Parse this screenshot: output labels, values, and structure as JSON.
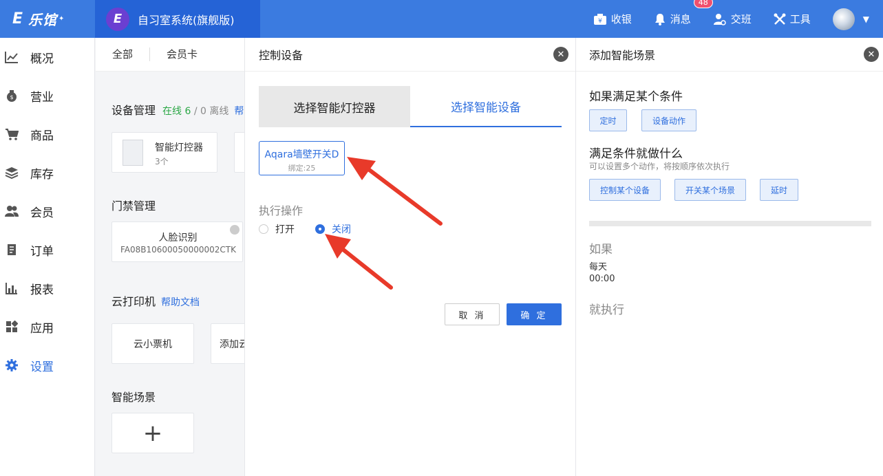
{
  "header": {
    "brand": "乐馆",
    "store_name": "自习室系统(旗舰版)",
    "actions": [
      {
        "label": "收银",
        "icon": "cashier-icon"
      },
      {
        "label": "消息",
        "icon": "bell-icon",
        "badge": "48"
      },
      {
        "label": "交班",
        "icon": "handover-icon"
      },
      {
        "label": "工具",
        "icon": "tools-icon"
      }
    ]
  },
  "sidebar": {
    "items": [
      {
        "label": "概况",
        "icon": "chart-line-icon"
      },
      {
        "label": "营业",
        "icon": "money-bag-icon"
      },
      {
        "label": "商品",
        "icon": "cart-icon"
      },
      {
        "label": "库存",
        "icon": "layers-icon"
      },
      {
        "label": "会员",
        "icon": "users-icon"
      },
      {
        "label": "订单",
        "icon": "receipt-icon"
      },
      {
        "label": "报表",
        "icon": "bar-chart-icon"
      },
      {
        "label": "应用",
        "icon": "apps-icon"
      },
      {
        "label": "设置",
        "icon": "gear-icon",
        "active": true
      }
    ]
  },
  "settings": {
    "tabs": [
      "全部",
      "会员卡"
    ],
    "device_mgmt": {
      "title": "设备管理",
      "online": "在线 6",
      "sep": " / ",
      "offline": "0 离线",
      "help": "帮"
    },
    "device_card": {
      "name": "智能灯控器",
      "count": "3个"
    },
    "door": {
      "title": "门禁管理",
      "card_name": "人脸识别",
      "card_id": "FA08B10600050000002CTK"
    },
    "printer": {
      "title": "云打印机",
      "help": "帮助文档",
      "card1": "云小票机",
      "card2": "添加云"
    },
    "scene": {
      "title": "智能场景",
      "add": "+"
    }
  },
  "control_panel": {
    "title": "控制设备",
    "tabs": [
      "选择智能灯控器",
      "选择智能设备"
    ],
    "device": {
      "name": "Aqara墙壁开关D",
      "bind": "绑定:25"
    },
    "op_label": "执行操作",
    "options": [
      {
        "label": "打开",
        "checked": false
      },
      {
        "label": "关闭",
        "checked": true
      }
    ],
    "cancel": "取 消",
    "ok": "确 定"
  },
  "scene_panel": {
    "title": "添加智能场景",
    "cond_title": "如果满足某个条件",
    "cond_chips": [
      "定时",
      "设备动作"
    ],
    "do_title": "满足条件就做什么",
    "do_hint": "可以设置多个动作，将按顺序依次执行",
    "do_chips": [
      "控制某个设备",
      "开关某个场景",
      "延时"
    ],
    "if_label": "如果",
    "if_value1": "每天",
    "if_value2": "00:00",
    "then_label": "就执行"
  },
  "colors": {
    "primary": "#2f6fde",
    "header": "#3b7be0",
    "annotation": "#e83a2a"
  }
}
